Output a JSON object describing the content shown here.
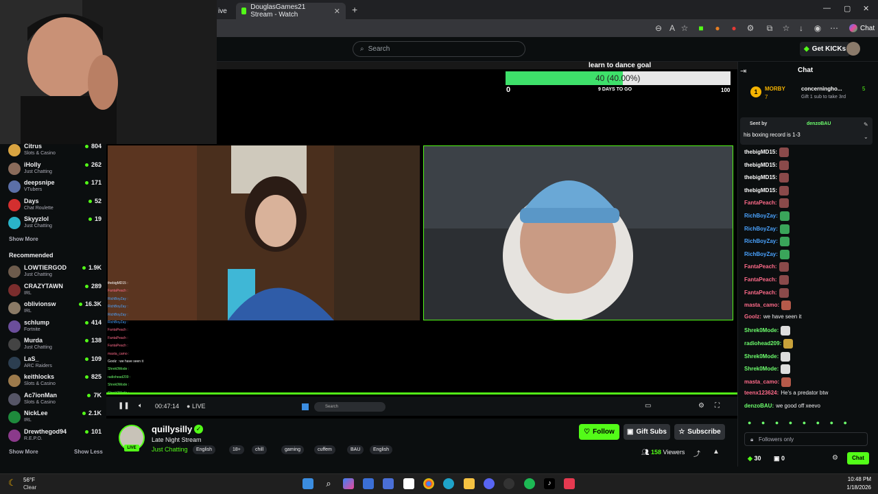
{
  "browser": {
    "tabs": [
      {
        "label": "ive"
      },
      {
        "label": "DouglasGames21 Stream - Watch"
      }
    ],
    "new_tab": "+",
    "chat_label": "Chat"
  },
  "header": {
    "search_placeholder": "Search",
    "get_kicks": "Get KICKs"
  },
  "sidebar": {
    "following": [
      {
        "name": "Citrus",
        "category": "Slots & Casino",
        "viewers": "804",
        "color": "#d9a441"
      },
      {
        "name": "iHolly",
        "category": "Just Chatting",
        "viewers": "262",
        "color": "#8a6b5a"
      },
      {
        "name": "deepsnipe",
        "category": "VTubers",
        "viewers": "171",
        "color": "#5b6fa8"
      },
      {
        "name": "Days",
        "category": "Chat Roulette",
        "viewers": "52",
        "color": "#d32f2f"
      },
      {
        "name": "Skyyzlol",
        "category": "Just Chatting",
        "viewers": "19",
        "color": "#2ab3c9"
      }
    ],
    "show_more_1": "Show More",
    "recommended_heading": "Recommended",
    "recommended": [
      {
        "name": "LOWTIERGOD",
        "category": "Just Chatting",
        "viewers": "1.9K",
        "color": "#6d5b4c"
      },
      {
        "name": "CRAZYTAWN",
        "category": "IRL",
        "viewers": "289",
        "color": "#7b2d2d"
      },
      {
        "name": "oblivionsw",
        "category": "IRL",
        "viewers": "16.3K",
        "color": "#8a7a66"
      },
      {
        "name": "schlump",
        "category": "Fortnite",
        "viewers": "414",
        "color": "#6b4e9b"
      },
      {
        "name": "Murda",
        "category": "Just Chatting",
        "viewers": "138",
        "color": "#444"
      },
      {
        "name": "LaS_",
        "category": "ARC Raiders",
        "viewers": "109",
        "color": "#2c3e50"
      },
      {
        "name": "keithlocks",
        "category": "Slots & Casino",
        "viewers": "825",
        "color": "#9c7a4b"
      },
      {
        "name": "Ac7ionMan",
        "category": "Slots & Casino",
        "viewers": "7K",
        "color": "#556"
      },
      {
        "name": "NickLee",
        "category": "IRL",
        "viewers": "2.1K",
        "color": "#1e8a3c"
      },
      {
        "name": "Drewthegod94",
        "category": "R.E.P.O.",
        "viewers": "101",
        "color": "#8b3a8b"
      }
    ],
    "show_more_2": "Show More",
    "show_less": "Show Less"
  },
  "goal": {
    "title": "learn to dance goal",
    "progress_text": "40 (40.00%)",
    "progress_fraction": 0.4,
    "min": "0",
    "max": "100",
    "days_left": "9 DAYS TO GO"
  },
  "mini_chat": [
    {
      "user": "thebigMD15 :",
      "color": "#fff"
    },
    {
      "user": "FantaPeach :",
      "color": "#ff6b8a"
    },
    {
      "user": "RichBoyZay :",
      "color": "#4aa3ff"
    },
    {
      "user": "RichBoyZay :",
      "color": "#4aa3ff"
    },
    {
      "user": "RichBoyZay :",
      "color": "#4aa3ff"
    },
    {
      "user": "RichBoyZay :",
      "color": "#4aa3ff"
    },
    {
      "user": "FantaPeach :",
      "color": "#ff6b8a"
    },
    {
      "user": "FantaPeach :",
      "color": "#ff6b8a"
    },
    {
      "user": "FantaPeach :",
      "color": "#ff6b8a"
    },
    {
      "user": "masta_camo :",
      "color": "#ff6b8a"
    },
    {
      "user": "Goolz : we have seen it",
      "color": "#fff"
    },
    {
      "user": "Shrek0Mode :",
      "color": "#6dff6d"
    },
    {
      "user": "radiohead209 :",
      "color": "#6dff6d"
    },
    {
      "user": "Shrek0Mode :",
      "color": "#6dff6d"
    },
    {
      "user": "Shrek0Mode :",
      "color": "#6dff6d"
    }
  ],
  "player": {
    "time": "00:47:14",
    "live": "LIVE",
    "inner_search": "Search"
  },
  "stream": {
    "channel": "quillysilly",
    "title": "Late Night Stream",
    "category": "Just Chatting",
    "live_badge": "LIVE",
    "tags": [
      "English",
      "18+",
      "chill",
      "gaming",
      "cuffem",
      "BAU",
      "English"
    ],
    "viewers": "158",
    "viewers_label": "Viewers",
    "follow": "Follow",
    "gift_subs": "Gift Subs",
    "subscribe": "Subscribe"
  },
  "chat": {
    "title": "Chat",
    "leader_name": "MORBY",
    "leader_count": "7",
    "leader2_name": "concerningho...",
    "leader2_count": "5",
    "leader_hint": "Gift 1 sub to take 3rd",
    "pinned_by": "Sent by",
    "pinned_user": "denzoBAU",
    "pinned_text": "his boxing record is 1-3",
    "messages": [
      {
        "user": "thebigMD15:",
        "text": "",
        "color": "#ffffff",
        "emote": "#8a4a4a"
      },
      {
        "user": "thebigMD15:",
        "text": "",
        "color": "#ffffff",
        "emote": "#8a4a4a"
      },
      {
        "user": "thebigMD15:",
        "text": "",
        "color": "#ffffff",
        "emote": "#8a4a4a"
      },
      {
        "user": "thebigMD15:",
        "text": "",
        "color": "#ffffff",
        "emote": "#8a4a4a"
      },
      {
        "user": "FantaPeach:",
        "text": "",
        "color": "#ff6b8a",
        "emote": "#8a4a4a"
      },
      {
        "user": "RichBoyZay:",
        "text": "",
        "color": "#4aa3ff",
        "emote": "#3aa55a"
      },
      {
        "user": "RichBoyZay:",
        "text": "",
        "color": "#4aa3ff",
        "emote": "#3aa55a"
      },
      {
        "user": "RichBoyZay:",
        "text": "",
        "color": "#4aa3ff",
        "emote": "#3aa55a"
      },
      {
        "user": "RichBoyZay:",
        "text": "",
        "color": "#4aa3ff",
        "emote": "#3aa55a"
      },
      {
        "user": "FantaPeach:",
        "text": "",
        "color": "#ff6b8a",
        "emote": "#8a4a4a"
      },
      {
        "user": "FantaPeach:",
        "text": "",
        "color": "#ff6b8a",
        "emote": "#8a4a4a"
      },
      {
        "user": "FantaPeach:",
        "text": "",
        "color": "#ff6b8a",
        "emote": "#8a4a4a"
      },
      {
        "user": "masta_camo:",
        "text": "",
        "color": "#ff6b8a",
        "emote": "#b55a4a"
      },
      {
        "user": "Goolz:",
        "text": "we have seen it",
        "color": "#ff6b8a",
        "emote": ""
      },
      {
        "user": "Shrek0Mode:",
        "text": "",
        "color": "#6dff6d",
        "emote": "#dddddd"
      },
      {
        "user": "radiohead209:",
        "text": "",
        "color": "#6dff6d",
        "emote": "#c9a23a"
      },
      {
        "user": "Shrek0Mode:",
        "text": "",
        "color": "#6dff6d",
        "emote": "#dddddd"
      },
      {
        "user": "Shrek0Mode:",
        "text": "",
        "color": "#6dff6d",
        "emote": "#dddddd"
      },
      {
        "user": "masta_camo:",
        "text": "",
        "color": "#ff6b8a",
        "emote": "#b55a4a"
      },
      {
        "user": "teenx123624:",
        "text": "He's a predator btw",
        "color": "#ff6b8a",
        "emote": ""
      },
      {
        "user": "denzoBAU:",
        "text": "we good off xeevo",
        "color": "#6dff6d",
        "emote": ""
      }
    ],
    "followers_only": "Followers only",
    "kicks_count": "30",
    "gifts_count": "0",
    "send": "Chat"
  },
  "taskbar": {
    "temp": "56°F",
    "weather": "Clear",
    "time": "10:48 PM",
    "date": "1/18/2026"
  },
  "colors": {
    "brand": "#53fc18",
    "background": "#0b0e0f"
  }
}
